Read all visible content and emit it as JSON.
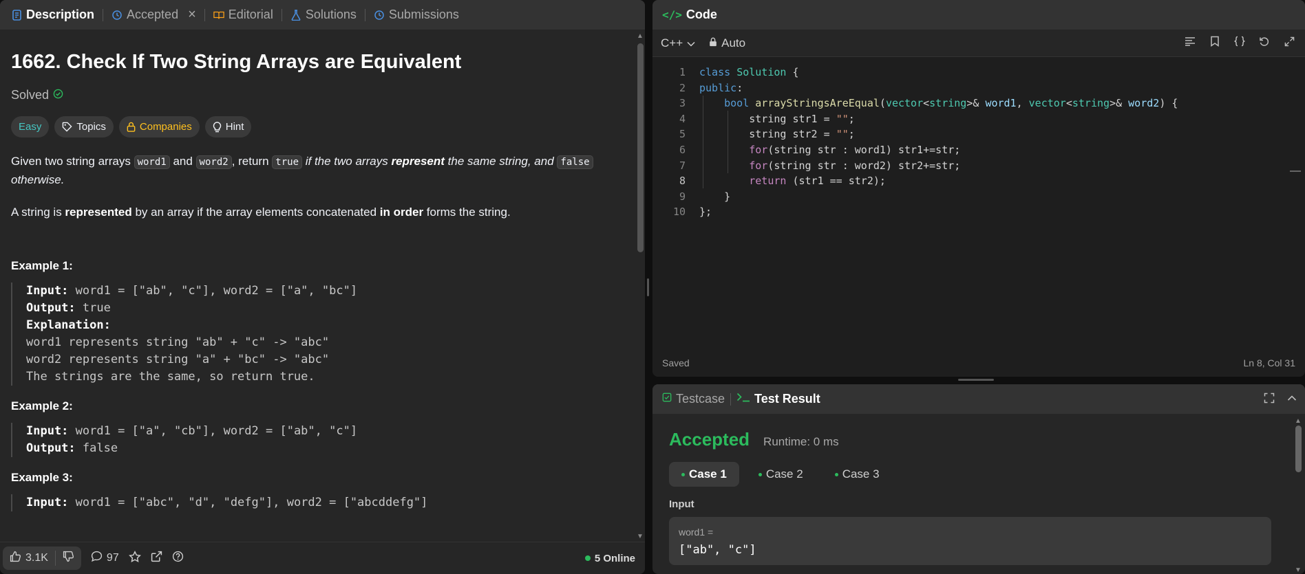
{
  "left_tabs": {
    "description": "Description",
    "accepted": "Accepted",
    "editorial": "Editorial",
    "solutions": "Solutions",
    "submissions": "Submissions"
  },
  "problem": {
    "title": "1662. Check If Two String Arrays are Equivalent",
    "status": "Solved",
    "chips": {
      "difficulty": "Easy",
      "topics": "Topics",
      "companies": "Companies",
      "hint": "Hint"
    },
    "p1": {
      "a": "Given two string arrays ",
      "c1": "word1",
      "b": " and ",
      "c2": "word2",
      "c": ", return ",
      "c3": "true",
      "d": " if the two arrays ",
      "e": "represent",
      "f": " the same string, and ",
      "c4": "false",
      "g": "otherwise."
    },
    "p2": {
      "a": "A string is ",
      "b": "represented",
      "c": " by an array if the array elements concatenated ",
      "d": "in order",
      "e": " forms the string."
    },
    "examples": [
      {
        "heading": "Example 1:",
        "input_label": "Input:",
        "input": " word1 = [\"ab\", \"c\"], word2 = [\"a\", \"bc\"]",
        "output_label": "Output:",
        "output": " true",
        "explanation_label": "Explanation:",
        "explanation": [
          "word1 represents string \"ab\" + \"c\" -> \"abc\"",
          "word2 represents string \"a\" + \"bc\" -> \"abc\"",
          "The strings are the same, so return true."
        ]
      },
      {
        "heading": "Example 2:",
        "input_label": "Input:",
        "input": " word1 = [\"a\", \"cb\"], word2 = [\"ab\", \"c\"]",
        "output_label": "Output:",
        "output": " false"
      },
      {
        "heading": "Example 3:",
        "input_label": "Input:",
        "input": " word1 = [\"abc\", \"d\", \"defg\"], word2 = [\"abcddefg\"]"
      }
    ]
  },
  "footer": {
    "likes": "3.1K",
    "comments": "97",
    "online": "5 Online"
  },
  "code": {
    "tab": "Code",
    "language": "C++",
    "mode": "Auto",
    "status_left": "Saved",
    "status_right": "Ln 8, Col 31",
    "line_numbers": [
      "1",
      "2",
      "3",
      "4",
      "5",
      "6",
      "7",
      "8",
      "9",
      "10"
    ]
  },
  "results": {
    "tab_testcase": "Testcase",
    "tab_result": "Test Result",
    "verdict": "Accepted",
    "runtime": "Runtime: 0 ms",
    "cases": [
      "Case 1",
      "Case 2",
      "Case 3"
    ],
    "input_label": "Input",
    "var_label": "word1 =",
    "var_value": "[\"ab\", \"c\"]"
  },
  "colors": {
    "accent_green": "#2cbb5d",
    "easy": "#46c6c2",
    "companies": "#ffc01e",
    "active_tab_icon": "#4a90e2"
  },
  "icons": {
    "description": "document-icon",
    "accepted": "history-icon",
    "editorial": "book-icon",
    "solutions": "flask-icon",
    "submissions": "history-icon"
  }
}
